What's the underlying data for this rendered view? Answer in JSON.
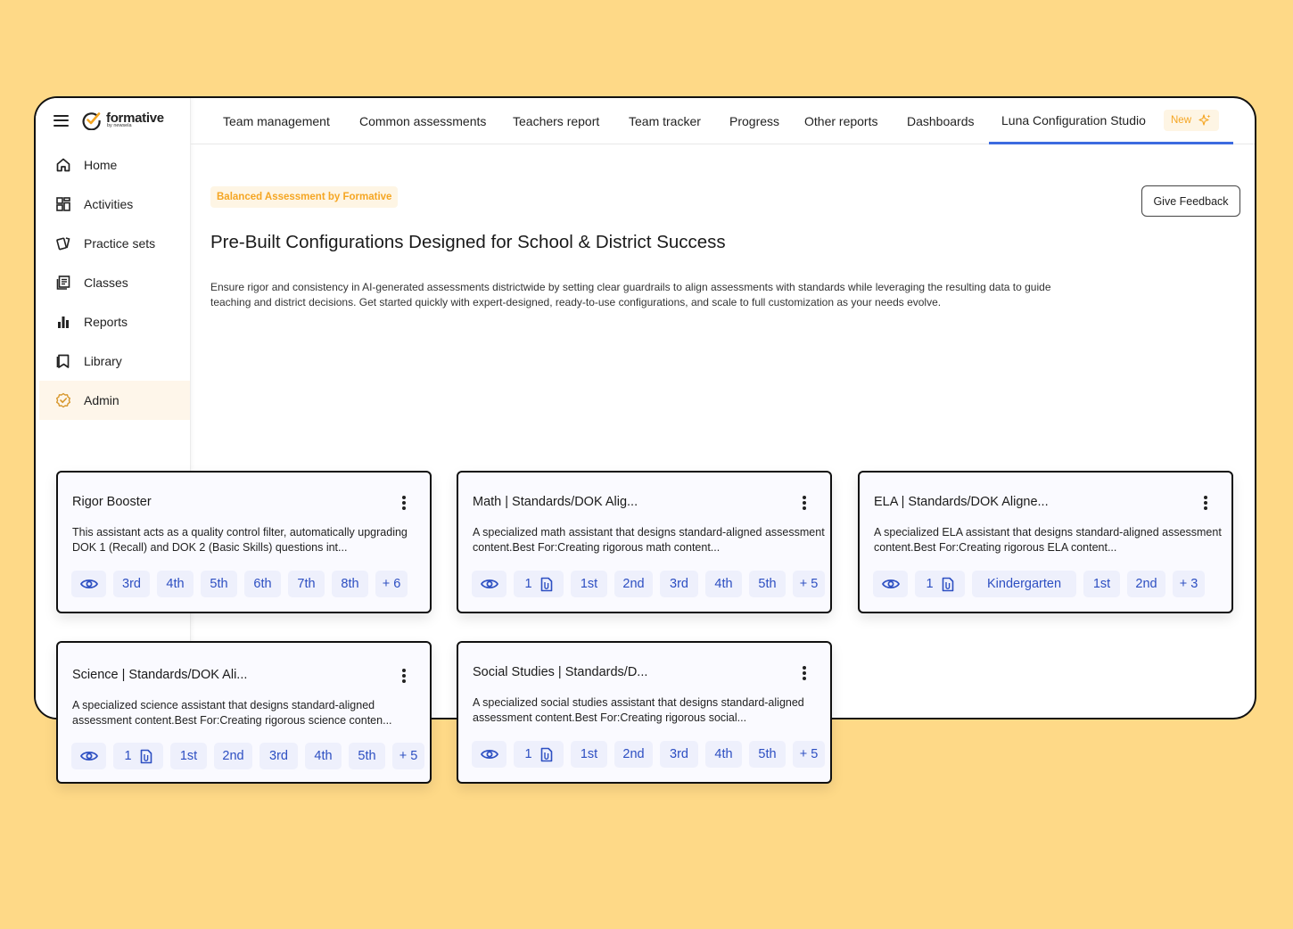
{
  "colors": {
    "accent": "#3D6BE0",
    "chip_bg": "#EEF0FC",
    "chip_text": "#2D4FC2",
    "badge_orange": "#F5A623",
    "page_bg": "#FED987"
  },
  "brand": {
    "name": "formative",
    "subline": "by newsela"
  },
  "sidebar": {
    "items": [
      {
        "label": "Home",
        "icon": "home-icon"
      },
      {
        "label": "Activities",
        "icon": "grid-icon"
      },
      {
        "label": "Practice sets",
        "icon": "cards-icon"
      },
      {
        "label": "Classes",
        "icon": "classes-icon"
      },
      {
        "label": "Reports",
        "icon": "bar-chart-icon"
      },
      {
        "label": "Library",
        "icon": "bookmark-icon"
      },
      {
        "label": "Admin",
        "icon": "admin-badge-icon",
        "active": true
      }
    ]
  },
  "topnav": {
    "tabs": [
      "Team management",
      "Common assessments",
      "Teachers report",
      "Team tracker",
      "Progress",
      "Other reports",
      "Dashboards",
      "Luna Configuration Studio"
    ],
    "active_tab": "Luna Configuration Studio",
    "new_badge": "New"
  },
  "main": {
    "pill": "Balanced Assessment by Formative",
    "feedback_label": "Give Feedback",
    "headline": "Pre-Built Configurations Designed for School & District Success",
    "description": "Ensure rigor and consistency in AI-generated assessments districtwide by setting clear guardrails to align assessments with standards while leveraging the resulting data to guide teaching and district decisions. Get started quickly with expert-designed, ready-to-use configurations, and scale to full customization as your needs evolve."
  },
  "cards": [
    {
      "title": "Rigor Booster",
      "desc": "This assistant acts as a quality control filter, automatically upgrading DOK 1 (Recall) and DOK 2 (Basic Skills) questions int...",
      "chips": [
        "eye-icon",
        "3rd",
        "4th",
        "5th",
        "6th",
        "7th",
        "8th",
        "+ 6"
      ]
    },
    {
      "title": "Math | Standards/DOK Alig...",
      "desc": "A specialized math assistant that designs standard-aligned assessment content.Best For:Creating rigorous math content...",
      "chips": [
        "eye-icon",
        "1 doc-icon",
        "1st",
        "2nd",
        "3rd",
        "4th",
        "5th",
        "+ 5"
      ]
    },
    {
      "title": "ELA | Standards/DOK Aligne...",
      "desc": "A specialized ELA assistant that designs standard-aligned assessment content.Best For:Creating rigorous ELA content...",
      "chips": [
        "eye-icon",
        "1 doc-icon",
        "Kindergarten",
        "1st",
        "2nd",
        "+ 3"
      ]
    },
    {
      "title": "Science | Standards/DOK Ali...",
      "desc": "A specialized science assistant that designs standard-aligned assessment content.Best For:Creating rigorous science conten...",
      "chips": [
        "eye-icon",
        "1 doc-icon",
        "1st",
        "2nd",
        "3rd",
        "4th",
        "5th",
        "+ 5"
      ]
    },
    {
      "title": "Social Studies | Standards/D...",
      "desc": "A specialized social studies assistant that designs standard-aligned assessment content.Best For:Creating rigorous social...",
      "chips": [
        "eye-icon",
        "1 doc-icon",
        "1st",
        "2nd",
        "3rd",
        "4th",
        "5th",
        "+ 5"
      ]
    }
  ]
}
